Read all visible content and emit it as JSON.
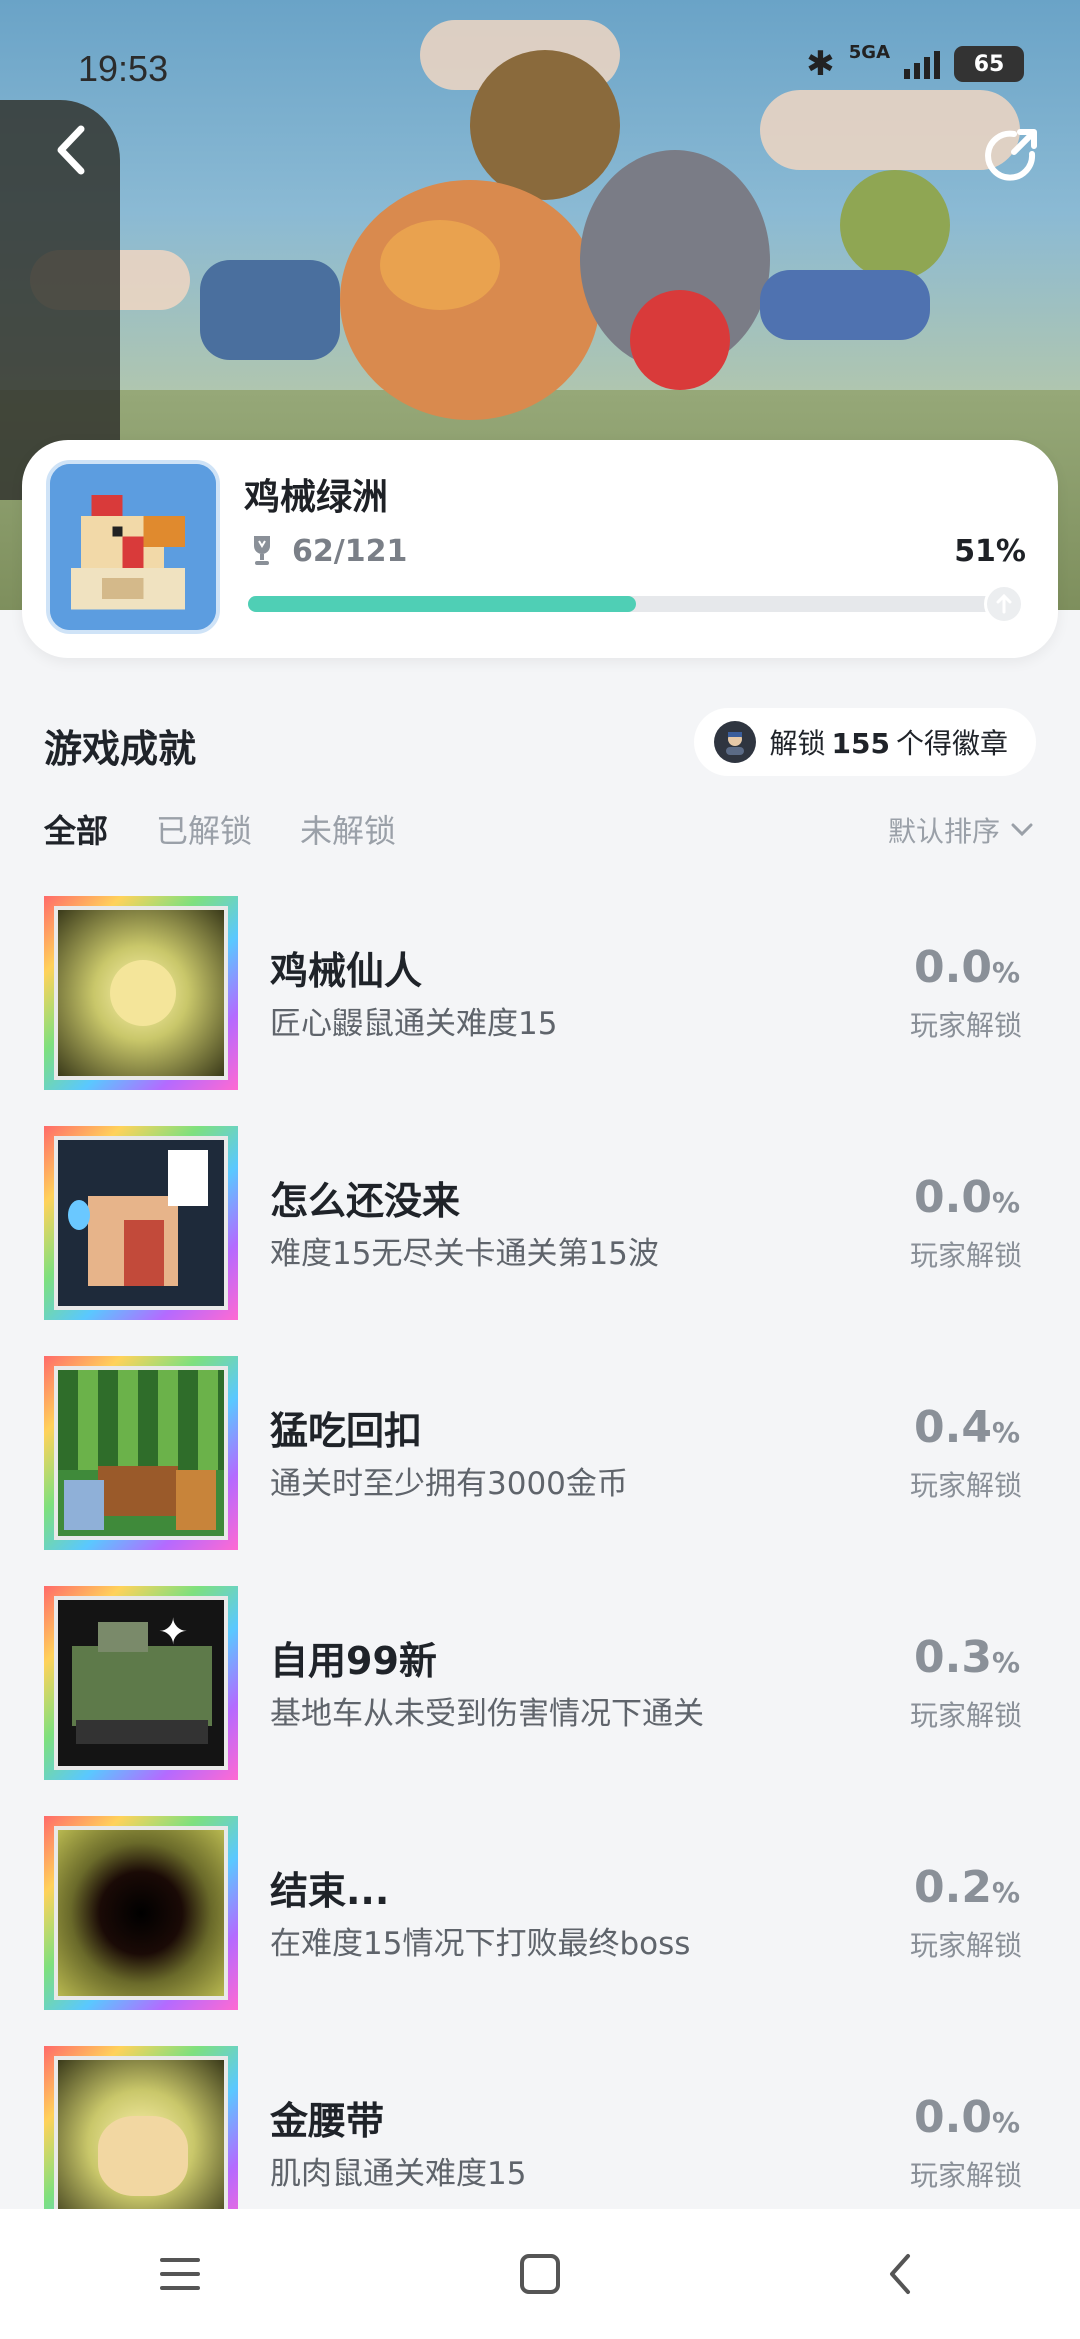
{
  "status_bar": {
    "time": "19:53",
    "network": "5GA",
    "battery": "65"
  },
  "game": {
    "title": "鸡械绿洲",
    "progress": "62/121",
    "percent": "51%",
    "progress_fraction": 0.51
  },
  "section": {
    "title": "游戏成就",
    "badge_prefix": "解锁",
    "badge_count": "155",
    "badge_suffix": "个得徽章"
  },
  "tabs": [
    "全部",
    "已解锁",
    "未解锁"
  ],
  "sort_label": "默认排序",
  "rate_label": "玩家解锁",
  "achievements": [
    {
      "name": "鸡械仙人",
      "desc": "匠心鼹鼠通关难度15",
      "rate": "0.0",
      "icon": "glowing-chick-icon"
    },
    {
      "name": "怎么还没来",
      "desc": "难度15无尽关卡通关第15波",
      "rate": "0.0",
      "icon": "waiting-chicken-icon"
    },
    {
      "name": "猛吃回扣",
      "desc": "通关时至少拥有3000金币",
      "rate": "0.4",
      "icon": "treasure-chest-icon"
    },
    {
      "name": "自用99新",
      "desc": "基地车从未受到伤害情况下通关",
      "rate": "0.3",
      "icon": "tank-icon"
    },
    {
      "name": "结束...",
      "desc": "在难度15情况下打败最终boss",
      "rate": "0.2",
      "icon": "dark-hole-icon"
    },
    {
      "name": "金腰带",
      "desc": "肌肉鼠通关难度15",
      "rate": "0.0",
      "icon": "golden-mouse-icon"
    }
  ]
}
